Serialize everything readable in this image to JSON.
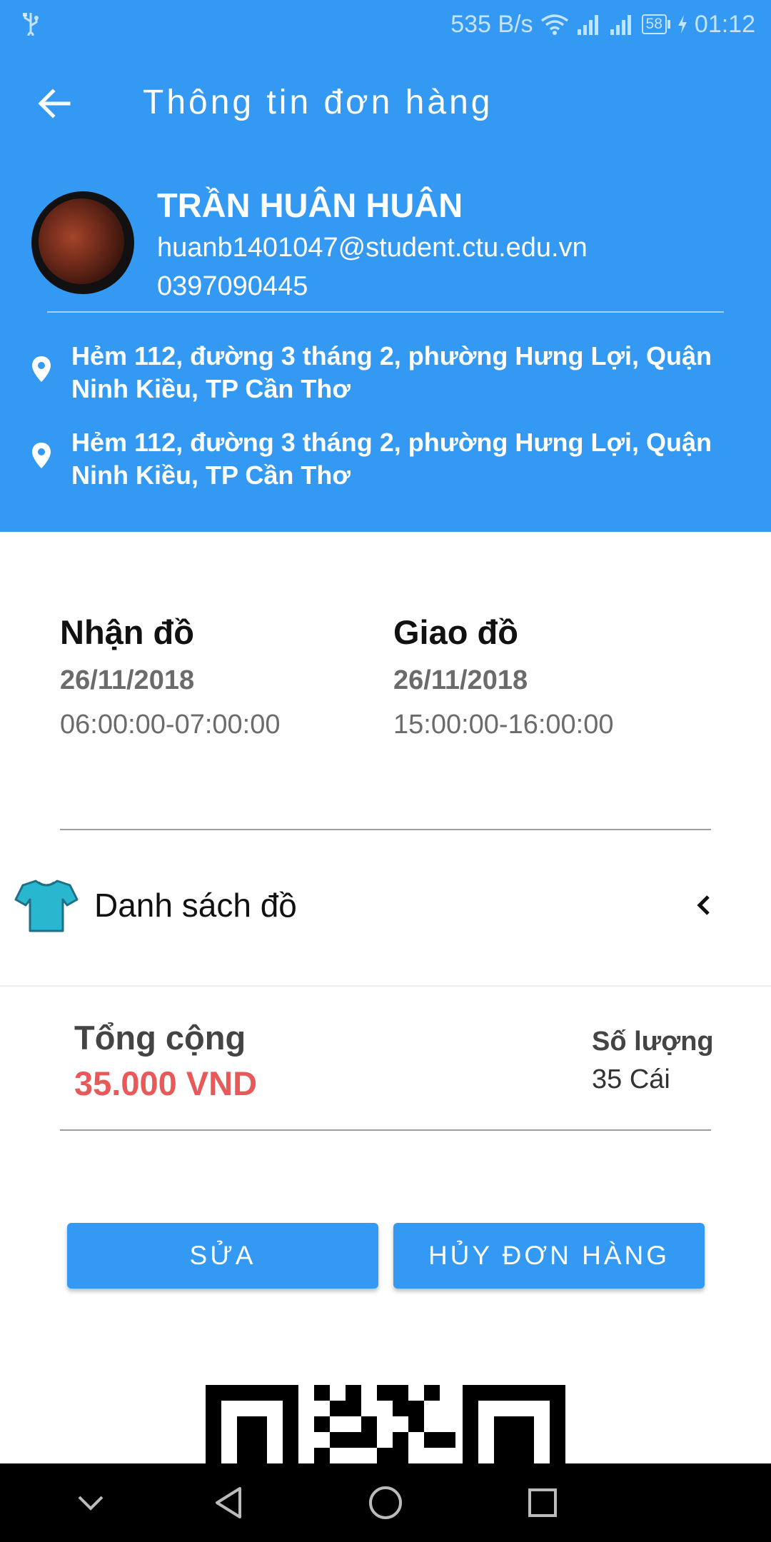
{
  "status_bar": {
    "net_speed": "535 B/s",
    "battery": "58",
    "time": "01:12"
  },
  "toolbar": {
    "title": "Thông tin đơn hàng"
  },
  "profile": {
    "name": "TRẦN HUÂN HUÂN",
    "email": "huanb1401047@student.ctu.edu.vn",
    "phone": "0397090445"
  },
  "addresses": [
    "Hẻm 112, đường 3 tháng 2, phường Hưng Lợi, Quận Ninh Kiều, TP Cần Thơ",
    "Hẻm 112, đường 3 tháng 2, phường Hưng Lợi, Quận Ninh Kiều, TP Cần Thơ"
  ],
  "schedule": {
    "receive": {
      "label": "Nhận đồ",
      "date": "26/11/2018",
      "time": "06:00:00-07:00:00"
    },
    "deliver": {
      "label": "Giao đồ",
      "date": "26/11/2018",
      "time": "15:00:00-16:00:00"
    }
  },
  "clothes": {
    "label": "Danh sách đồ"
  },
  "totals": {
    "total_label": "Tổng cộng",
    "total_value": "35.000 VND",
    "qty_label": "Số lượng",
    "qty_value": "35 Cái"
  },
  "actions": {
    "edit_label": "SỬA",
    "cancel_label": "HỦY ĐƠN HÀNG"
  },
  "colors": {
    "primary": "#3399f3",
    "total_red": "#e85a5a",
    "shirt": "#29b6cf"
  }
}
